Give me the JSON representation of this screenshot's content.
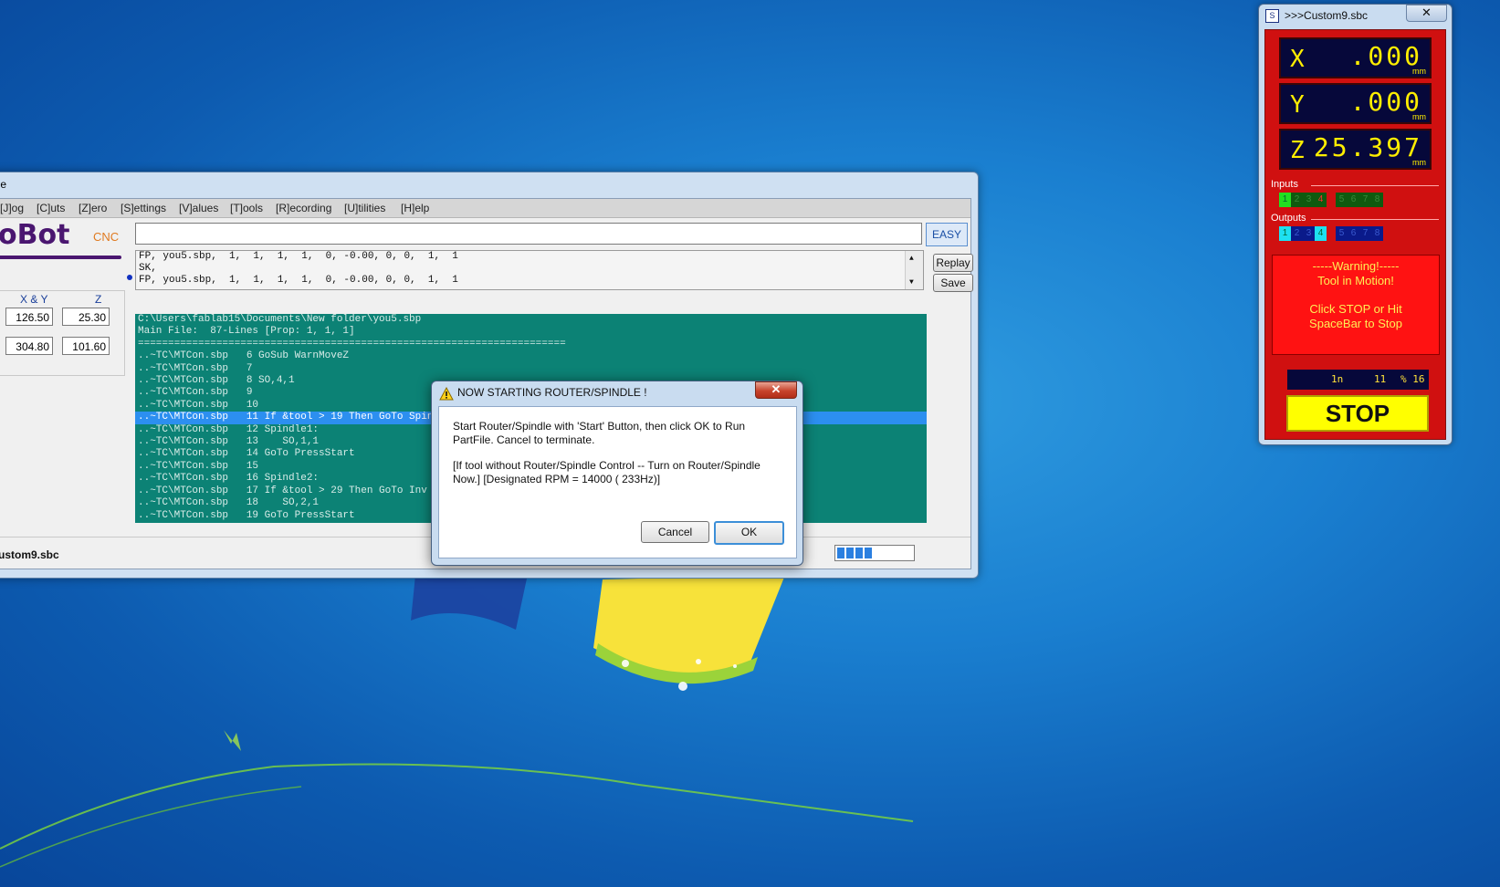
{
  "main_window": {
    "title_fragment": "ole",
    "menu": [
      "[J]og",
      "[C]uts",
      "[Z]ero",
      "[S]ettings",
      "[V]alues",
      "[T]ools",
      "[R]ecording",
      "[U]tilities",
      "[H]elp"
    ],
    "logo_text": "oBot",
    "logo_sub": "CNC",
    "easy_label": "EASY",
    "history": [
      "FP, you5.sbp,  1,  1,  1,  1,  0, -0.00, 0, 0,  1,  1",
      "SK,",
      "FP, you5.sbp,  1,  1,  1,  1,  0, -0.00, 0, 0,  1,  1"
    ],
    "replay_label": "Replay",
    "save_label": "Save",
    "coords": {
      "xy_header": "X & Y",
      "z_header": "Z",
      "xy_1": "126.50",
      "z_1": "25.30",
      "xy_2": "304.80",
      "z_2": "101.60"
    },
    "output_lines": [
      "C:\\Users\\fablab15\\Documents\\New folder\\you5.sbp",
      "Main File:  87-Lines [Prop: 1, 1, 1]",
      "=======================================================================",
      "..~TC\\MTCon.sbp   6 GoSub WarnMoveZ",
      "..~TC\\MTCon.sbp   7",
      "..~TC\\MTCon.sbp   8 SO,4,1",
      "..~TC\\MTCon.sbp   9",
      "..~TC\\MTCon.sbp   10",
      "..~TC\\MTCon.sbp   11 If &tool > 19 Then GoTo Spindle2",
      "..~TC\\MTCon.sbp   12 Spindle1:",
      "..~TC\\MTCon.sbp   13    SO,1,1",
      "..~TC\\MTCon.sbp   14 GoTo PressStart",
      "..~TC\\MTCon.sbp   15",
      "..~TC\\MTCon.sbp   16 Spindle2:",
      "..~TC\\MTCon.sbp   17 If &tool > 29 Then GoTo Inv",
      "..~TC\\MTCon.sbp   18    SO,2,1",
      "..~TC\\MTCon.sbp   19 GoTo PressStart"
    ],
    "highlighted_line": 8,
    "file_label": "ustom9.sbc",
    "progress_blocks": 4
  },
  "dialog": {
    "title": "NOW STARTING ROUTER/SPINDLE !",
    "message1": "Start Router/Spindle with 'Start' Button, then click OK to Run PartFile. Cancel to terminate.",
    "message2": "[If tool without Router/Spindle Control -- Turn on Router/Spindle Now.]  [Designated RPM = 14000 ( 233Hz)]",
    "cancel_label": "Cancel",
    "ok_label": "OK",
    "close_label": "✕"
  },
  "dro": {
    "title": ">>>Custom9.sbc",
    "close_label": "✕",
    "x_label": "X",
    "x_value": ".000",
    "x_unit": "mm",
    "y_label": "Y",
    "y_value": ".000",
    "y_unit": "mm",
    "z_label": "Z",
    "z_value": "25.397",
    "z_unit": "mm",
    "inputs_label": "Inputs",
    "inputs": [
      "1",
      "2",
      "3",
      "4",
      "5",
      "6",
      "7",
      "8"
    ],
    "outputs_label": "Outputs",
    "outputs": [
      "1",
      "2",
      "3",
      "4",
      "5",
      "6",
      "7",
      "8"
    ],
    "warning_title": "-----Warning!-----",
    "warning_line2": "Tool in Motion!",
    "warning_line3": "Click STOP or Hit",
    "warning_line4": "SpaceBar to Stop",
    "status_unit": "1n",
    "status_line": "11",
    "status_pct": "% 16",
    "stop_label": "STOP"
  },
  "colors": {
    "desktop": "#1a7fd0",
    "output_bg": "#0c8275",
    "highlight": "#2c8ff0",
    "dro_red": "#d01010",
    "dro_yellow": "#ffee00",
    "stop_yellow": "#ffff00"
  }
}
